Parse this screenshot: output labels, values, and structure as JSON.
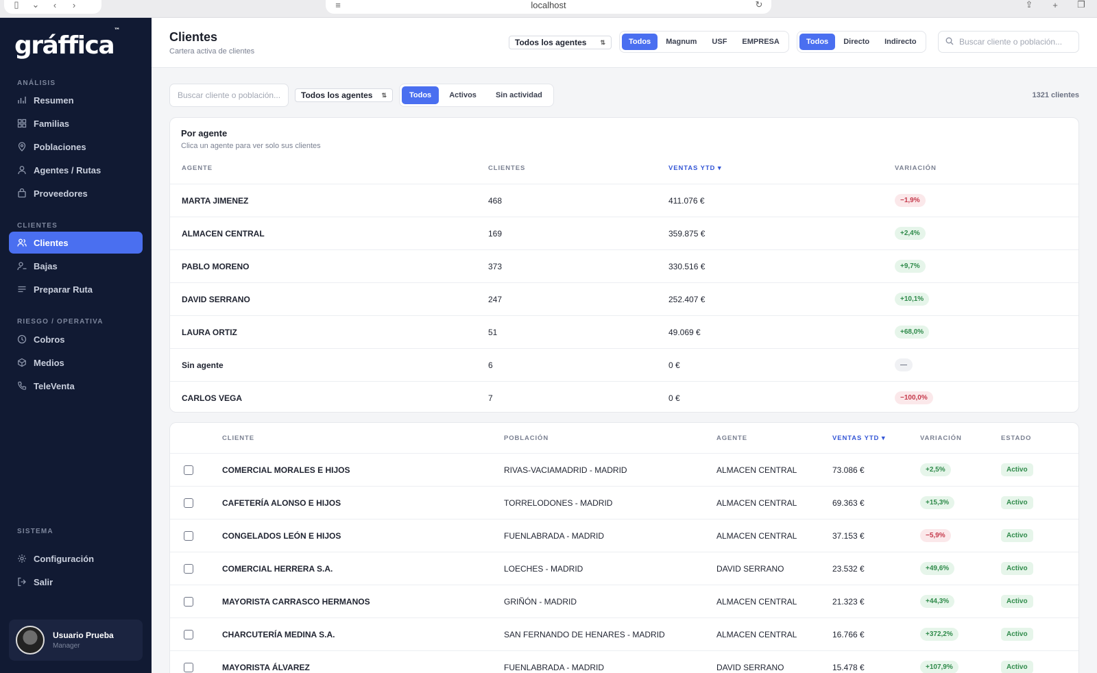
{
  "browser": {
    "address": "localhost"
  },
  "app": {
    "logo": "gráffica",
    "logo_mark": "™"
  },
  "sidebar": {
    "sections": [
      {
        "label": "ANÁLISIS"
      },
      {
        "label": "CLIENTES"
      },
      {
        "label": "RIESGO / OPERATIVA"
      },
      {
        "label": "SISTEMA"
      }
    ],
    "items": [
      {
        "label": "Resumen",
        "icon": "bar-chart-icon"
      },
      {
        "label": "Familias",
        "icon": "grid-icon"
      },
      {
        "label": "Poblaciones",
        "icon": "map-pin-icon"
      },
      {
        "label": "Agentes / Rutas",
        "icon": "user-icon"
      },
      {
        "label": "Proveedores",
        "icon": "bag-icon"
      },
      {
        "label": "Clientes",
        "icon": "users-icon",
        "active": true
      },
      {
        "label": "Bajas",
        "icon": "user-minus-icon"
      },
      {
        "label": "Preparar Ruta",
        "icon": "list-icon"
      },
      {
        "label": "Cobros",
        "icon": "clock-icon"
      },
      {
        "label": "Medios",
        "icon": "box-icon"
      },
      {
        "label": "TeleVenta",
        "icon": "phone-icon"
      },
      {
        "label": "Configuración",
        "icon": "gear-icon"
      },
      {
        "label": "Salir",
        "icon": "logout-icon"
      }
    ],
    "user": {
      "name": "Usuario Prueba",
      "role": "Manager"
    }
  },
  "header": {
    "title": "Clientes",
    "subtitle": "Cartera activa de clientes",
    "agent_select": "Todos los agentes",
    "company_seg": [
      "Todos",
      "Magnum",
      "USF",
      "EMPRESA"
    ],
    "channel_seg": [
      "Todos",
      "Directo",
      "Indirecto"
    ],
    "search_placeholder": "Buscar cliente o población..."
  },
  "filters": {
    "search_placeholder": "Buscar cliente o población...",
    "agent_select": "Todos los agentes",
    "status_seg": [
      "Todos",
      "Activos",
      "Sin actividad"
    ],
    "count": "1321 clientes"
  },
  "by_agent": {
    "title": "Por agente",
    "subtitle": "Clica un agente para ver solo sus clientes",
    "headers": {
      "agent": "AGENTE",
      "clients": "CLIENTES",
      "sales": "VENTAS YTD ▾",
      "variation": "VARIACIÓN"
    },
    "rows": [
      {
        "agent": "MARTA JIMENEZ",
        "clients": "468",
        "sales": "411.076 €",
        "variation": "−1,9%",
        "trend": "neg"
      },
      {
        "agent": "ALMACEN CENTRAL",
        "clients": "169",
        "sales": "359.875 €",
        "variation": "+2,4%",
        "trend": "pos"
      },
      {
        "agent": "PABLO MORENO",
        "clients": "373",
        "sales": "330.516 €",
        "variation": "+9,7%",
        "trend": "pos"
      },
      {
        "agent": "DAVID SERRANO",
        "clients": "247",
        "sales": "252.407 €",
        "variation": "+10,1%",
        "trend": "pos"
      },
      {
        "agent": "LAURA ORTIZ",
        "clients": "51",
        "sales": "49.069 €",
        "variation": "+68,0%",
        "trend": "pos"
      },
      {
        "agent": "Sin agente",
        "clients": "6",
        "sales": "0 €",
        "variation": "—",
        "trend": "neu"
      },
      {
        "agent": "CARLOS VEGA",
        "clients": "7",
        "sales": "0 €",
        "variation": "−100,0%",
        "trend": "neg"
      }
    ]
  },
  "clients_table": {
    "headers": {
      "client": "CLIENTE",
      "town": "POBLACIÓN",
      "agent": "AGENTE",
      "sales": "VENTAS YTD ▾",
      "variation": "VARIACIÓN",
      "status": "ESTADO"
    },
    "rows": [
      {
        "client": "COMERCIAL MORALES E HIJOS",
        "town": "RIVAS-VACIAMADRID - MADRID",
        "agent": "ALMACEN CENTRAL",
        "sales": "73.086 €",
        "variation": "+2,5%",
        "trend": "pos",
        "status": "Activo"
      },
      {
        "client": "CAFETERÍA ALONSO E HIJOS",
        "town": "TORRELODONES - MADRID",
        "agent": "ALMACEN CENTRAL",
        "sales": "69.363 €",
        "variation": "+15,3%",
        "trend": "pos",
        "status": "Activo"
      },
      {
        "client": "CONGELADOS LEÓN E HIJOS",
        "town": "FUENLABRADA - MADRID",
        "agent": "ALMACEN CENTRAL",
        "sales": "37.153 €",
        "variation": "−5,9%",
        "trend": "neg",
        "status": "Activo"
      },
      {
        "client": "COMERCIAL HERRERA S.A.",
        "town": "LOECHES - MADRID",
        "agent": "DAVID SERRANO",
        "sales": "23.532 €",
        "variation": "+49,6%",
        "trend": "pos",
        "status": "Activo"
      },
      {
        "client": "MAYORISTA CARRASCO HERMANOS",
        "town": "GRIÑÓN - MADRID",
        "agent": "ALMACEN CENTRAL",
        "sales": "21.323 €",
        "variation": "+44,3%",
        "trend": "pos",
        "status": "Activo"
      },
      {
        "client": "CHARCUTERÍA MEDINA S.A.",
        "town": "SAN FERNANDO DE HENARES - MADRID",
        "agent": "ALMACEN CENTRAL",
        "sales": "16.766 €",
        "variation": "+372,2%",
        "trend": "pos",
        "status": "Activo"
      },
      {
        "client": "MAYORISTA ÁLVAREZ",
        "town": "FUENLABRADA - MADRID",
        "agent": "DAVID SERRANO",
        "sales": "15.478 €",
        "variation": "+107,9%",
        "trend": "pos",
        "status": "Activo"
      }
    ]
  },
  "colors": {
    "sidebar_bg": "#111a33",
    "accent": "#4a6ff0",
    "positive": "#2f8a4a",
    "negative": "#c5394b"
  }
}
